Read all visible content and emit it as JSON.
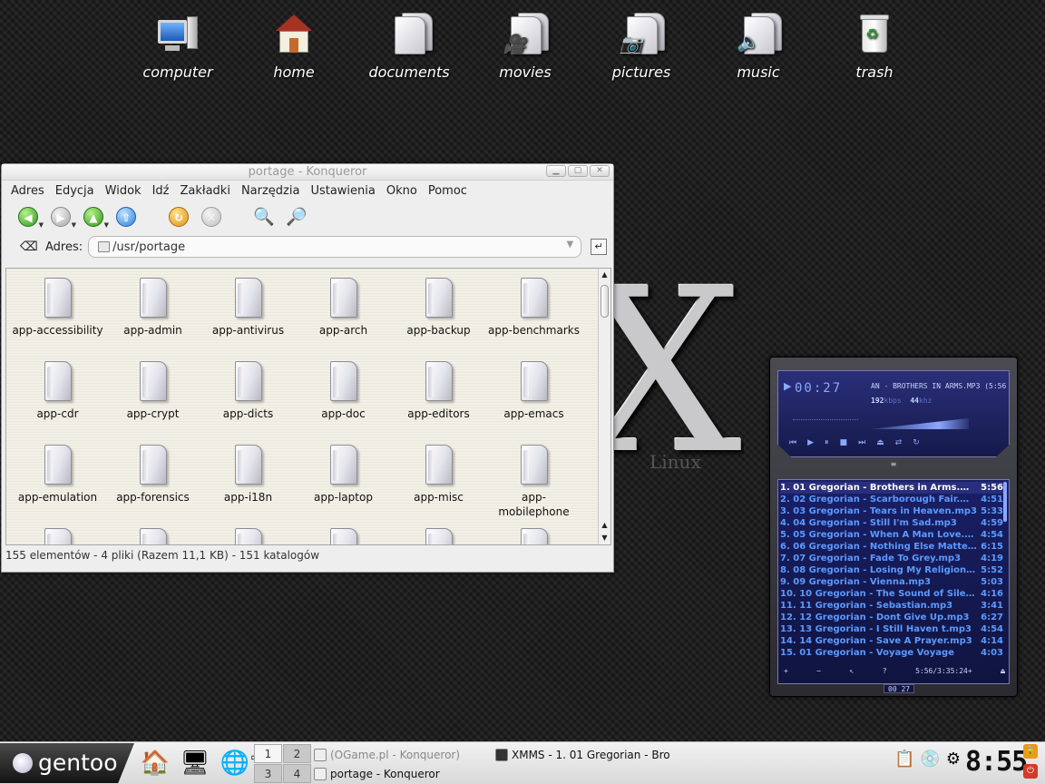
{
  "desktop": {
    "icons": [
      {
        "label": "computer",
        "icon": "computer-icon"
      },
      {
        "label": "home",
        "icon": "home-icon"
      },
      {
        "label": "documents",
        "icon": "documents-icon"
      },
      {
        "label": "movies",
        "icon": "movies-icon"
      },
      {
        "label": "pictures",
        "icon": "pictures-icon"
      },
      {
        "label": "music",
        "icon": "music-icon"
      },
      {
        "label": "trash",
        "icon": "trash-icon"
      }
    ],
    "logo_text": "X",
    "logo_sub": "Linux"
  },
  "konqueror": {
    "title": "portage - Konqueror",
    "menu": [
      "Adres",
      "Edycja",
      "Widok",
      "Idź",
      "Zakładki",
      "Narzędzia",
      "Ustawienia",
      "Okno",
      "Pomoc"
    ],
    "address_label": "Adres:",
    "address_value": "/usr/portage",
    "folders": [
      "app-accessibility",
      "app-admin",
      "app-antivirus",
      "app-arch",
      "app-backup",
      "app-benchmarks",
      "app-cdr",
      "app-crypt",
      "app-dicts",
      "app-doc",
      "app-editors",
      "app-emacs",
      "app-emulation",
      "app-forensics",
      "app-i18n",
      "app-laptop",
      "app-misc",
      "app-mobilephone",
      "",
      "",
      "",
      "",
      "",
      ""
    ],
    "status": "155 elementów - 4 pliki (Razem 11,1 KB) - 151 katalogów"
  },
  "xmms": {
    "time": "00:27",
    "scroll_title": "AN - BROTHERS IN ARMS.MP3 (5:56",
    "bitrate": "192",
    "bitrate_unit": "kbps",
    "samplerate": "44",
    "samplerate_unit": "khz",
    "playlist": [
      {
        "title": "1. 01  Gregorian - Brothers in Arms.mp3",
        "dur": "5:56"
      },
      {
        "title": "2. 02  Gregorian - Scarborough Fair.mp3",
        "dur": "4:51"
      },
      {
        "title": "3. 03  Gregorian - Tears in Heaven.mp3",
        "dur": "5:33"
      },
      {
        "title": "4. 04  Gregorian - Still I'm Sad.mp3",
        "dur": "4:59"
      },
      {
        "title": "5. 05  Gregorian - When A Man Love.mp3",
        "dur": "4:54"
      },
      {
        "title": "6. 06  Gregorian - Nothing Else Matters...",
        "dur": "6:15"
      },
      {
        "title": "7. 07  Gregorian - Fade To Grey.mp3",
        "dur": "4:19"
      },
      {
        "title": "8. 08  Gregorian - Losing My Religion.mp3",
        "dur": "5:52"
      },
      {
        "title": "9. 09  Gregorian - Vienna.mp3",
        "dur": "5:03"
      },
      {
        "title": "10. 10  Gregorian - The Sound of Silence...",
        "dur": "4:16"
      },
      {
        "title": "11. 11  Gregorian - Sebastian.mp3",
        "dur": "3:41"
      },
      {
        "title": "12. 12  Gregorian - Dont Give Up.mp3",
        "dur": "6:27"
      },
      {
        "title": "13. 13  Gregorian - I Still Haven t.mp3",
        "dur": "4:54"
      },
      {
        "title": "14. 14  Gregorian - Save A Prayer.mp3",
        "dur": "4:14"
      },
      {
        "title": "15. 01  Gregorian - Voyage Voyage",
        "dur": "4:03"
      }
    ],
    "playlist_total": "5:56/3:35:24+",
    "mini_time": "00 27"
  },
  "taskbar": {
    "start_label": "gentoo",
    "pager": [
      "1",
      "2",
      "3",
      "4"
    ],
    "tasks": [
      {
        "label": "(OGame.pl - Konqueror)"
      },
      {
        "label": "XMMS - 1. 01  Gregorian - Bro"
      },
      {
        "label": "portage - Konqueror"
      }
    ],
    "clock": "8:55"
  }
}
